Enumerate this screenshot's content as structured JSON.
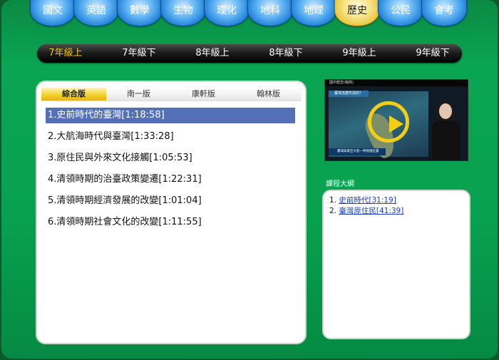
{
  "subject_tabs": [
    "國文",
    "英語",
    "數學",
    "生物",
    "理化",
    "地科",
    "地理",
    "歷史",
    "公民",
    "會考"
  ],
  "active_subject": "歷史",
  "grades": [
    "7年級上",
    "7年級下",
    "8年級上",
    "8年級下",
    "9年級上",
    "9年級下"
  ],
  "active_grade": "7年級上",
  "publishers": [
    "綜合版",
    "南一版",
    "康軒版",
    "翰林版"
  ],
  "active_publisher": "綜合版",
  "lessons": [
    "1.史前時代的臺灣[1:18:58]",
    "2.大航海時代與臺灣[1:33:28]",
    "3.原住民與外來文化接觸[1:05:53]",
    "4.清領時期的治臺政策變遷[1:22:31]",
    "5.清領時期經濟發展的改變[1:01:04]",
    "6.清領時期社會文化的改變[1:11:55]"
  ],
  "selected_lesson_index": 0,
  "video": {
    "top_label": "國中歷史(翰林)",
    "question": "臺灣怎麼形成的？",
    "caption": "臺灣與東亞大陸一帶地理位置"
  },
  "syllabus": {
    "title": "課程大綱",
    "items": [
      {
        "num": "1.",
        "label": "史前時代[31:19]"
      },
      {
        "num": "2.",
        "label": "臺灣原住民[41:39]"
      }
    ]
  },
  "colors": {
    "background": "#07a14f",
    "accent_yellow": "#f1c70e",
    "selection_blue": "#5471b8",
    "tab_blue": "#1e7fd6"
  }
}
